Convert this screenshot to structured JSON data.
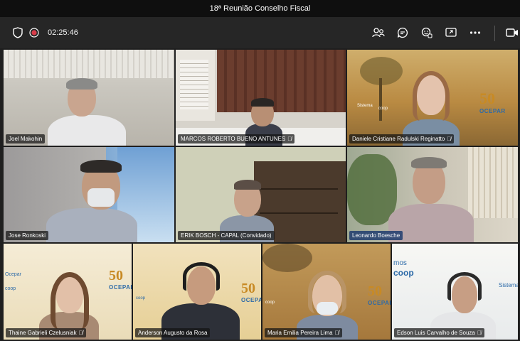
{
  "window": {
    "title": "18ª Reunião Conselho Fiscal"
  },
  "toolbar": {
    "timer": "02:25:46",
    "icons": [
      "shield-icon",
      "record-icon",
      "people-icon",
      "chat-icon",
      "react-icon",
      "share-icon",
      "more-icon",
      "camera-icon"
    ]
  },
  "tiles": [
    {
      "name": "Joel Makohin"
    },
    {
      "name": "MARCOS ROBERTO BUENO ANTUNES"
    },
    {
      "name": "Daniele Cristiane Radulski Reginatto"
    },
    {
      "name": "Jose Ronkoski"
    },
    {
      "name": "ERIK BOSCH - CAPAL (Convidado)"
    },
    {
      "name": "Leonardo Boesche"
    },
    {
      "name": "Thaine Gabrieli Czelusniak"
    },
    {
      "name": "Anderson Augusto da Rosa"
    },
    {
      "name": "Maria Emilia Pereira Lima"
    },
    {
      "name": "Edson Luis Carvalho de Souza"
    }
  ],
  "backgrounds": {
    "ocepar_number": "50",
    "ocepar_word": "OCEPAR",
    "sistema": "Sistema",
    "ocepar_small": "Ocepar",
    "coop": "coop",
    "somos": "mos"
  }
}
